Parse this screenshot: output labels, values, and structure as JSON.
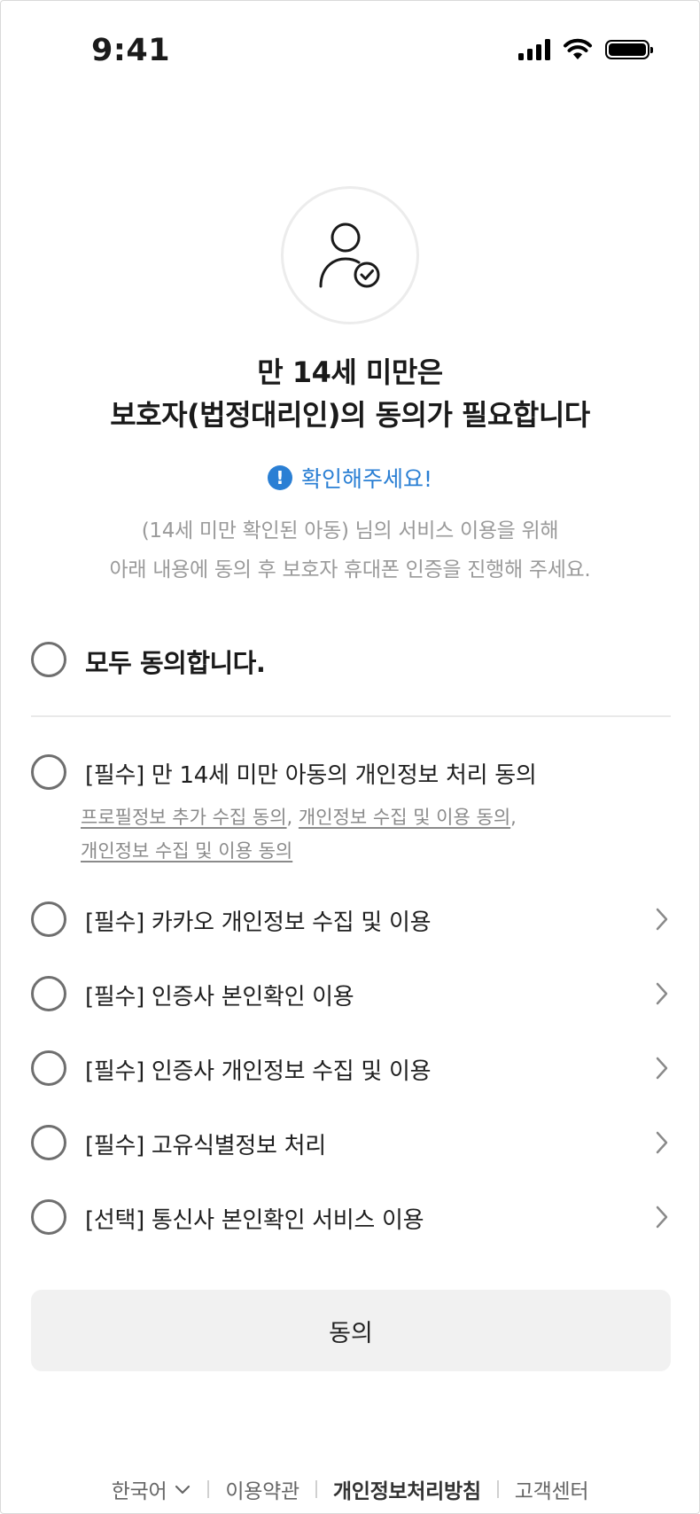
{
  "status_bar": {
    "time": "9:41"
  },
  "title": {
    "line1": "만 14세 미만은",
    "line2": "보호자(법정대리인)의 동의가 필요합니다"
  },
  "notice": {
    "icon_glyph": "!",
    "text": "확인해주세요!",
    "color": "#2a7fd4"
  },
  "description": {
    "line1": "(14세 미만 확인된 아동) 님의 서비스 이용을 위해",
    "line2": "아래 내용에 동의 후 보호자 휴대폰 인증을 진행해 주세요."
  },
  "agree_all": {
    "label": "모두 동의합니다."
  },
  "agreements": [
    {
      "label": "[필수] 만 14세 미만 아동의 개인정보 처리 동의",
      "sublinks": [
        "프로필정보 추가 수집 동의",
        "개인정보 수집 및 이용 동의",
        "개인정보 수집 및 이용 동의"
      ],
      "separator": ","
    },
    {
      "label": "[필수] 카카오 개인정보 수집 및 이용"
    },
    {
      "label": "[필수] 인증사 본인확인 이용"
    },
    {
      "label": "[필수] 인증사 개인정보 수집 및 이용"
    },
    {
      "label": "[필수] 고유식별정보 처리"
    },
    {
      "label": "[선택] 통신사 본인확인 서비스 이용"
    }
  ],
  "agree_button": {
    "label": "동의"
  },
  "footer": {
    "language": "한국어",
    "terms": "이용약관",
    "privacy": "개인정보처리방침",
    "support": "고객센터"
  }
}
